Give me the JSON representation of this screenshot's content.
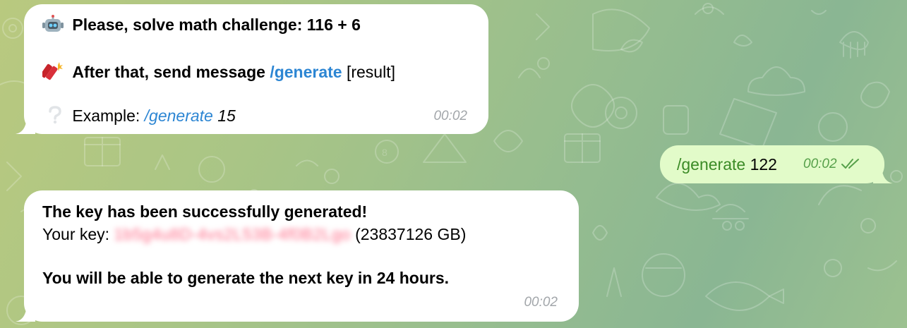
{
  "colors": {
    "incoming_bubble": "#ffffff",
    "outgoing_bubble": "#e2fbc9",
    "link": "#2d86d3",
    "outgoing_link": "#3b8b26",
    "outgoing_time": "#56a04a",
    "incoming_time": "#a2a6aa",
    "redacted_key": "#ff6a86"
  },
  "messages": [
    {
      "direction": "incoming",
      "challenge_icon": "robot-emoji",
      "challenge_text": "Please, solve math challenge: 116 + 6",
      "instruction_icon": "firecracker-emoji",
      "instruction_prefix": "After that, send message",
      "instruction_command": "/generate",
      "instruction_suffix": "[result]",
      "example_icon": "white-question-mark-emoji",
      "example_label": "Example:",
      "example_command": "/generate",
      "example_value": "15",
      "time": "00:02"
    },
    {
      "direction": "outgoing",
      "command": "/generate",
      "value": "122",
      "time": "00:02",
      "status": "read-double-check"
    },
    {
      "direction": "incoming",
      "headline": "The key has been successfully generated!",
      "key_label": "Your key:",
      "key_value": "1b5g4u8D-4vs2L53B-4f0B2Lgo",
      "key_size": "(23837126 GB)",
      "note": "You will be able to generate the next key in 24 hours.",
      "time": "00:02"
    }
  ]
}
